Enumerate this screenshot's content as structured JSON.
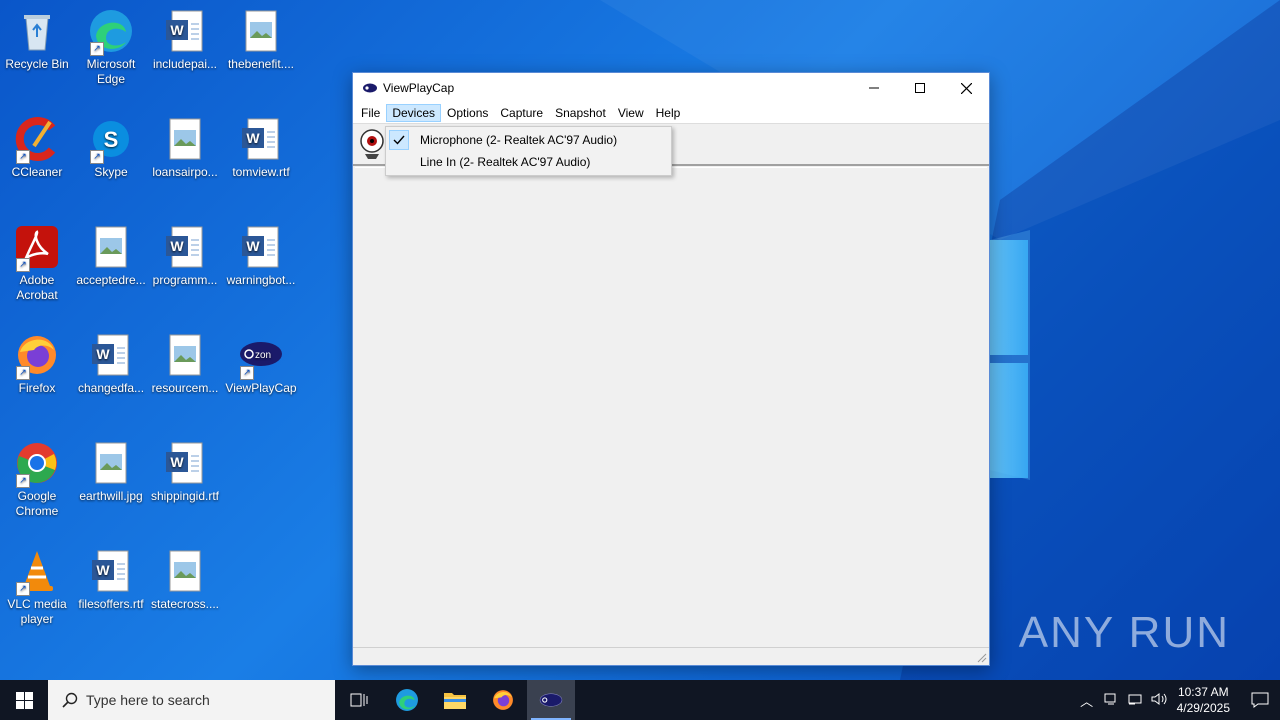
{
  "desktop": {
    "icons": [
      {
        "label": "Recycle Bin",
        "icon": "recycle-bin-icon"
      },
      {
        "label": "Microsoft Edge",
        "icon": "edge-icon"
      },
      {
        "label": "includepai...",
        "icon": "word-doc-icon"
      },
      {
        "label": "thebenefit....",
        "icon": "image-file-icon"
      },
      {
        "label": "CCleaner",
        "icon": "ccleaner-icon"
      },
      {
        "label": "Skype",
        "icon": "skype-icon"
      },
      {
        "label": "loansairpo...",
        "icon": "image-file-icon"
      },
      {
        "label": "tomview.rtf",
        "icon": "word-doc-icon"
      },
      {
        "label": "Adobe Acrobat",
        "icon": "acrobat-icon"
      },
      {
        "label": "acceptedre...",
        "icon": "image-file-icon"
      },
      {
        "label": "programm...",
        "icon": "word-doc-icon"
      },
      {
        "label": "warningbot...",
        "icon": "word-doc-icon"
      },
      {
        "label": "Firefox",
        "icon": "firefox-icon"
      },
      {
        "label": "changedfa...",
        "icon": "word-doc-icon"
      },
      {
        "label": "resourcem...",
        "icon": "image-file-icon"
      },
      {
        "label": "ViewPlayCap",
        "icon": "viewplaycap-icon"
      },
      {
        "label": "Google Chrome",
        "icon": "chrome-icon"
      },
      {
        "label": "earthwill.jpg",
        "icon": "image-file-icon"
      },
      {
        "label": "shippingid.rtf",
        "icon": "word-doc-icon"
      },
      {
        "label": "VLC media player",
        "icon": "vlc-icon"
      },
      {
        "label": "filesoffers.rtf",
        "icon": "word-doc-icon"
      },
      {
        "label": "statecross....",
        "icon": "image-file-icon"
      }
    ],
    "watermark": "ANY RUN"
  },
  "window": {
    "title": "ViewPlayCap",
    "menu": [
      "File",
      "Devices",
      "Options",
      "Capture",
      "Snapshot",
      "View",
      "Help"
    ],
    "active_menu": "Devices"
  },
  "dropdown": {
    "items": [
      {
        "label": "Microphone (2- Realtek AC'97 Audio)",
        "checked": true
      },
      {
        "label": "Line In (2- Realtek AC'97 Audio)",
        "checked": false
      }
    ]
  },
  "taskbar": {
    "search_placeholder": "Type here to search",
    "time": "10:37 AM",
    "date": "4/29/2025"
  }
}
